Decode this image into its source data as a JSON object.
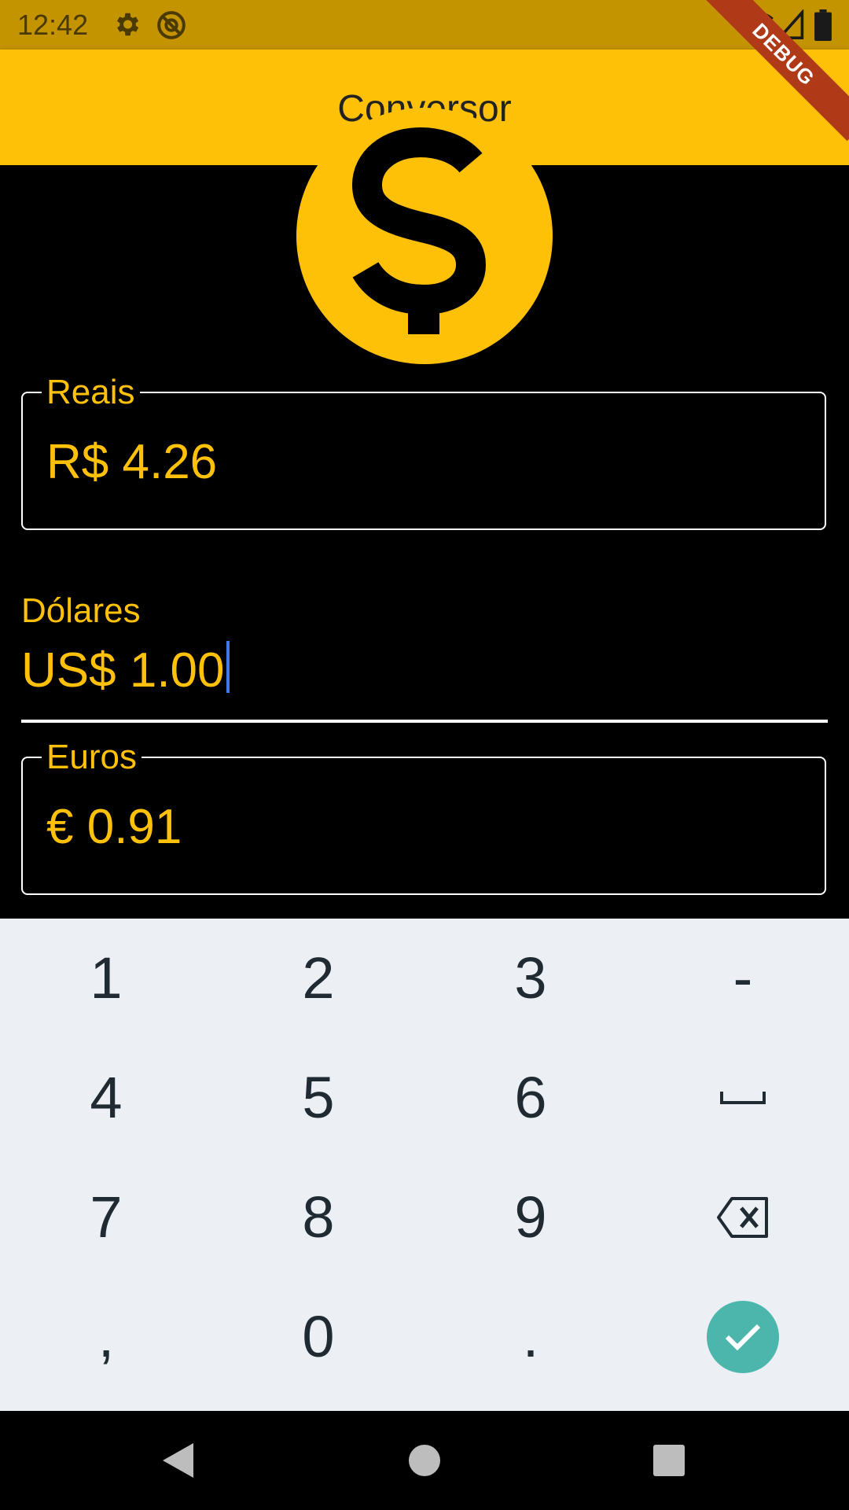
{
  "status_bar": {
    "time": "12:42",
    "icons": [
      "settings-icon",
      "at-icon",
      "wifi-icon",
      "signal-icon",
      "battery-icon"
    ],
    "background": "#C39300"
  },
  "app_bar": {
    "title": "Conversor",
    "background": "#FFC107"
  },
  "debug_banner": "DEBUG",
  "logo": {
    "icon": "dollar-coin-icon",
    "color": "#FFC107"
  },
  "fields": {
    "reais": {
      "label": "Reais",
      "value": "R$ 4.26"
    },
    "dolares": {
      "label": "Dólares",
      "value": "US$ 1.00",
      "focused": true
    },
    "euros": {
      "label": "Euros",
      "value": "€ 0.91"
    }
  },
  "keyboard": {
    "row1": [
      "1",
      "2",
      "3",
      "-"
    ],
    "row2": [
      "4",
      "5",
      "6"
    ],
    "row3": [
      "7",
      "8",
      "9"
    ],
    "row4": [
      ",",
      "0",
      "."
    ],
    "special_icons": [
      "space-icon",
      "backspace-icon",
      "check-icon"
    ],
    "enter_color": "#4DB6AC"
  },
  "nav_bar": {
    "icons": [
      "back-icon",
      "home-icon",
      "recents-icon"
    ]
  },
  "colors": {
    "accent": "#FFC107",
    "background": "#000000",
    "cursor": "#3D7BE8"
  }
}
